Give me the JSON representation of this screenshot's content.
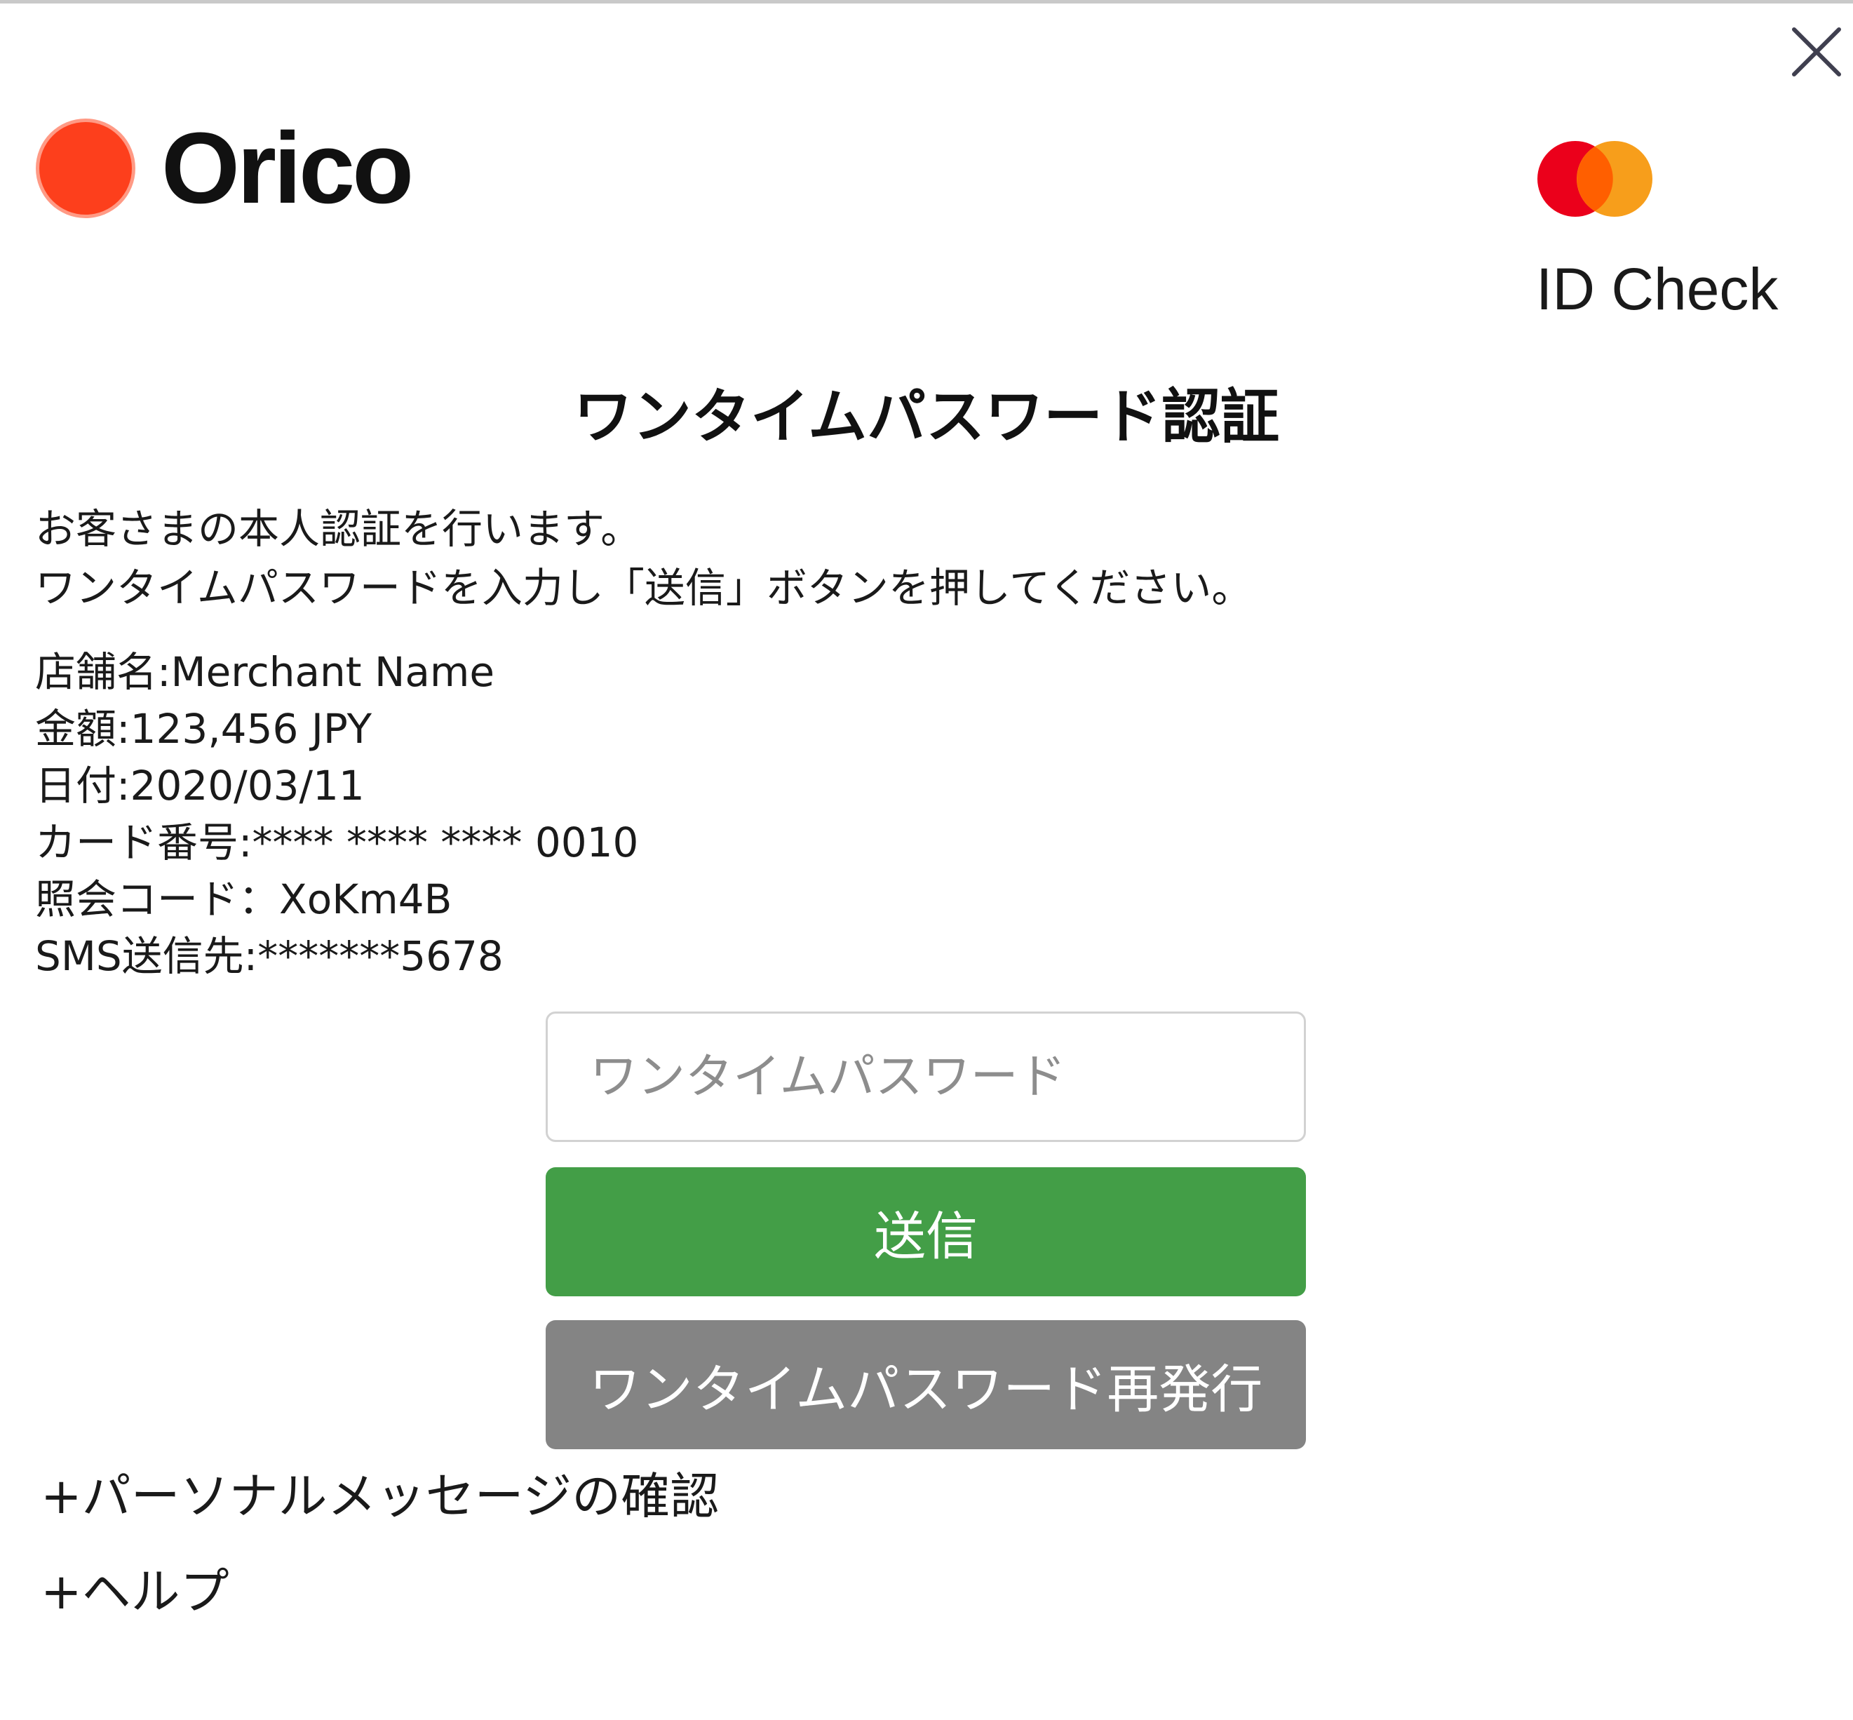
{
  "header": {
    "brand_name": "Orico",
    "idcheck_label": "ID Check",
    "close_icon": "close-icon",
    "colors": {
      "brand_red": "#fd3f1c",
      "mastercard_red": "#eb001b",
      "mastercard_orange": "#f79e1b"
    }
  },
  "title": "ワンタイムパスワード認証",
  "intro": {
    "line1": "お客さまの本人認証を行います。",
    "line2": "ワンタイムパスワードを入力し「送信」ボタンを押してください。"
  },
  "details": {
    "merchant": "店舗名:Merchant Name",
    "amount": "金額:123,456 JPY",
    "date": "日付:2020/03/11",
    "card_number": "カード番号:**** **** **** 0010",
    "reference_code": "照会コード：XoKm4B",
    "sms_destination": "SMS送信先:*******5678"
  },
  "form": {
    "otp_placeholder": "ワンタイムパスワード",
    "otp_value": "",
    "submit_label": "送信",
    "resend_label": "ワンタイムパスワード再発行",
    "submit_color": "#439e47",
    "resend_color": "#848484"
  },
  "links": {
    "personal_message": "+パーソナルメッセージの確認",
    "help": "+ヘルプ"
  }
}
